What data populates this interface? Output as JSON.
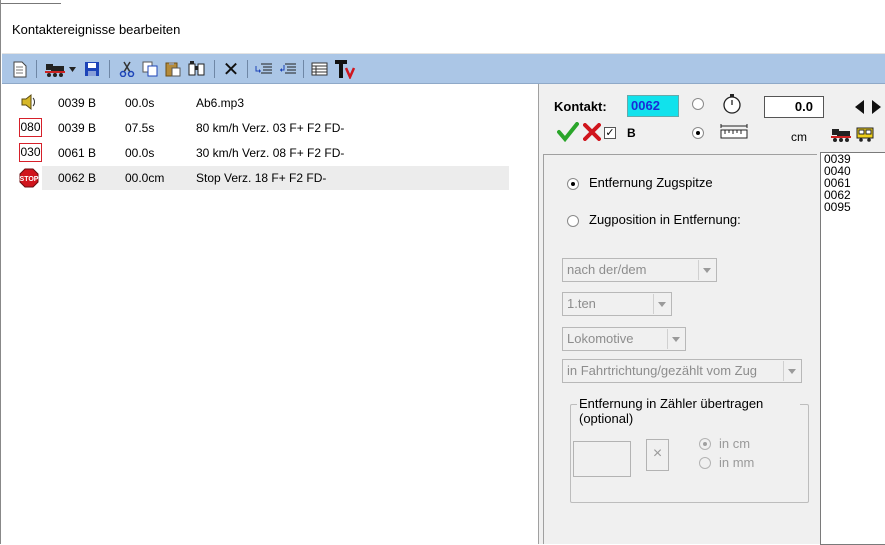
{
  "window": {
    "title": "Kontaktereignisse bearbeiten"
  },
  "toolbar": {
    "icons": [
      "new-document-icon",
      "locomotive-icon",
      "dropdown-arrow-icon",
      "save-icon",
      "cut-icon",
      "copy-icon",
      "paste-icon",
      "find-icon",
      "delete-icon",
      "indent-icon",
      "outdent-icon",
      "table-icon",
      "text-tool-icon"
    ],
    "delete_glyph": "✕"
  },
  "events": [
    {
      "icon": "sound-icon",
      "contact": "0039 B",
      "time": "00.0s",
      "desc": "Ab6.mp3",
      "selected": false
    },
    {
      "icon": "speed-sign-icon",
      "speed": "080",
      "contact": "0039 B",
      "time": "07.5s",
      "desc": "80 km/h Verz. 03 F+ F2  FD-",
      "selected": false
    },
    {
      "icon": "speed-sign-icon",
      "speed": "030",
      "contact": "0061 B",
      "time": "00.0s",
      "desc": "30 km/h Verz. 08 F+ F2  FD-",
      "selected": false
    },
    {
      "icon": "stop-sign-icon",
      "stop_text": "STOP",
      "contact": "0062 B",
      "time": "00.0cm",
      "desc": "Stop Verz. 18 F+ F2  FD-",
      "selected": true
    }
  ],
  "contact": {
    "label": "Kontakt:",
    "value": "0062",
    "time_value": "0.0",
    "unit": "cm",
    "b_label": "B",
    "b_checked": true,
    "timer_mode": false,
    "distance_mode": true
  },
  "options": {
    "distance_label": "Entfernung Zugspitze",
    "position_label": "Zugposition in Entfernung:",
    "selected": "distance",
    "combo_after": "nach der/dem",
    "combo_index": "1.ten",
    "combo_vehicle": "Lokomotive",
    "combo_direction": "in Fahrtrichtung/gezählt vom Zug",
    "group_title": "Entfernung in Zähler übertragen (optional)",
    "clear_glyph": "×",
    "unit_cm": "in cm",
    "unit_mm": "in mm"
  },
  "contact_ids": [
    "0039",
    "0040",
    "0061",
    "0062",
    "0095"
  ],
  "colors": {
    "toolbar_bg": "#abc6e6",
    "kontakt_highlight": "#11e2ec",
    "kontakt_text": "#1a2bd8",
    "speed_border": "#d6202a",
    "stop_red": "#d0151d",
    "accept_green": "#2aa52a",
    "cancel_red": "#d0151d"
  }
}
